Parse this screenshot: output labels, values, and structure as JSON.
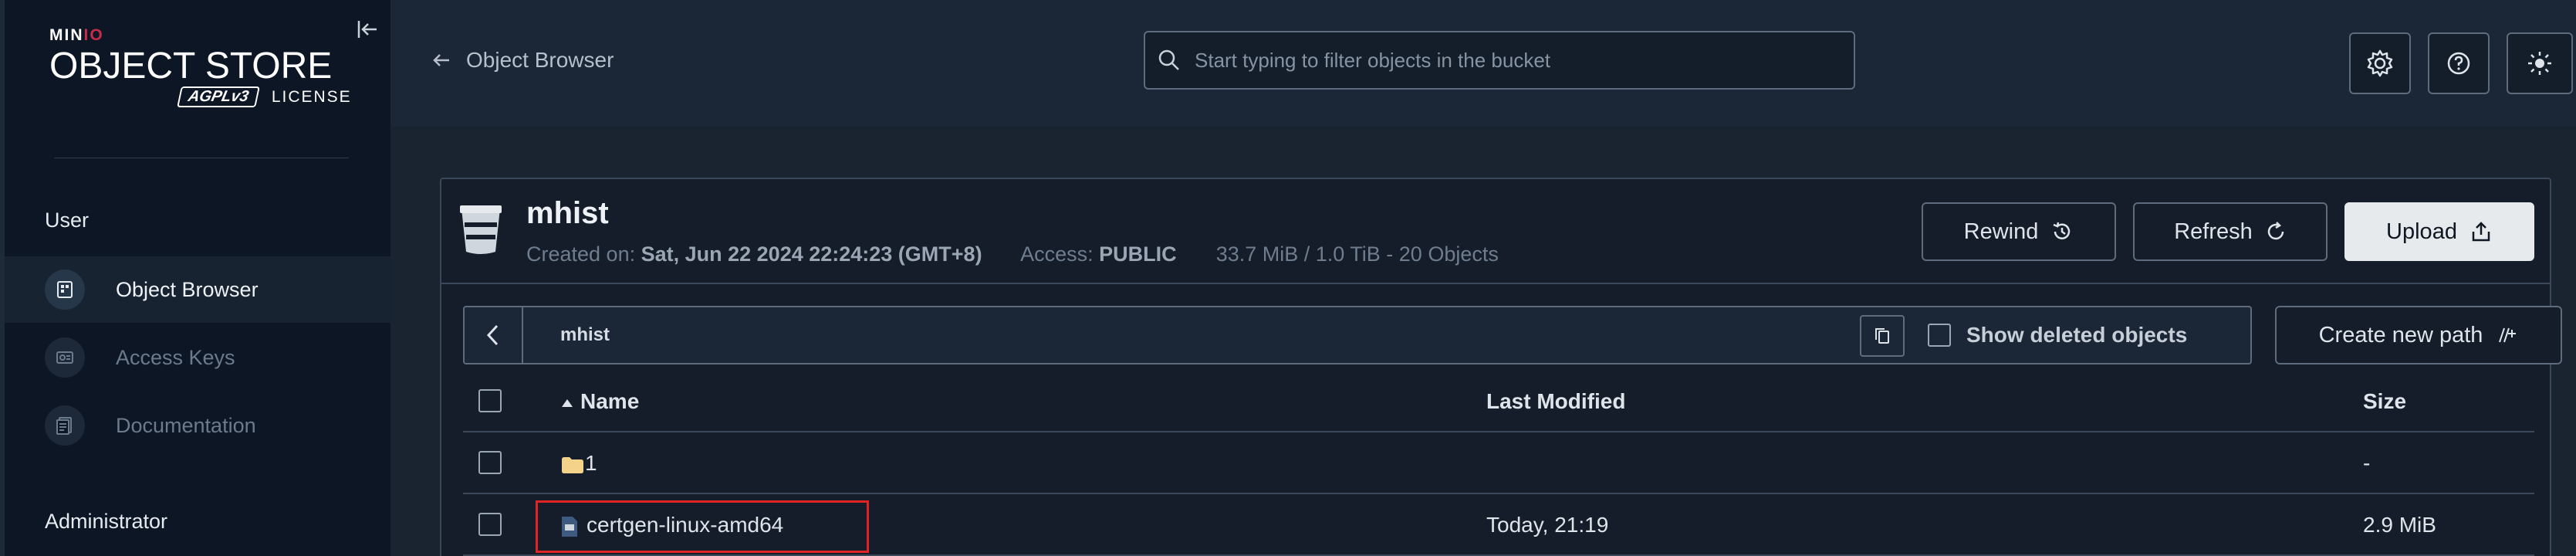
{
  "brand": {
    "mini_prefix": "MIN",
    "mini_suffix": "IO",
    "title": "OBJECT STORE",
    "agpl": "AGPLv3",
    "license": "LICENSE"
  },
  "sidebar": {
    "section_user": "User",
    "section_admin": "Administrator",
    "items": [
      {
        "label": "Object Browser",
        "icon": "object-browser-icon"
      },
      {
        "label": "Access Keys",
        "icon": "access-keys-icon"
      },
      {
        "label": "Documentation",
        "icon": "documentation-icon"
      }
    ]
  },
  "header": {
    "back_label": "Object Browser",
    "search_placeholder": "Start typing to filter objects in the bucket"
  },
  "bucket": {
    "name": "mhist",
    "created_label": "Created on:",
    "created_value": "Sat, Jun 22 2024 22:24:23 (GMT+8)",
    "access_label": "Access:",
    "access_value": "PUBLIC",
    "usage": "33.7 MiB / 1.0 TiB - 20 Objects",
    "buttons": {
      "rewind": "Rewind",
      "refresh": "Refresh",
      "upload": "Upload"
    }
  },
  "path": {
    "current": "mhist",
    "show_deleted": "Show deleted objects",
    "create_new_path": "Create new path"
  },
  "table": {
    "columns": {
      "name": "Name",
      "last_modified": "Last Modified",
      "size": "Size"
    },
    "rows": [
      {
        "name": "1",
        "type": "folder",
        "last_modified": "",
        "size": "-"
      },
      {
        "name": "certgen-linux-amd64",
        "type": "file",
        "last_modified": "Today, 21:19",
        "size": "2.9 MiB"
      }
    ]
  },
  "colors": {
    "accent": "#c72c48",
    "highlight": "#e02424"
  }
}
